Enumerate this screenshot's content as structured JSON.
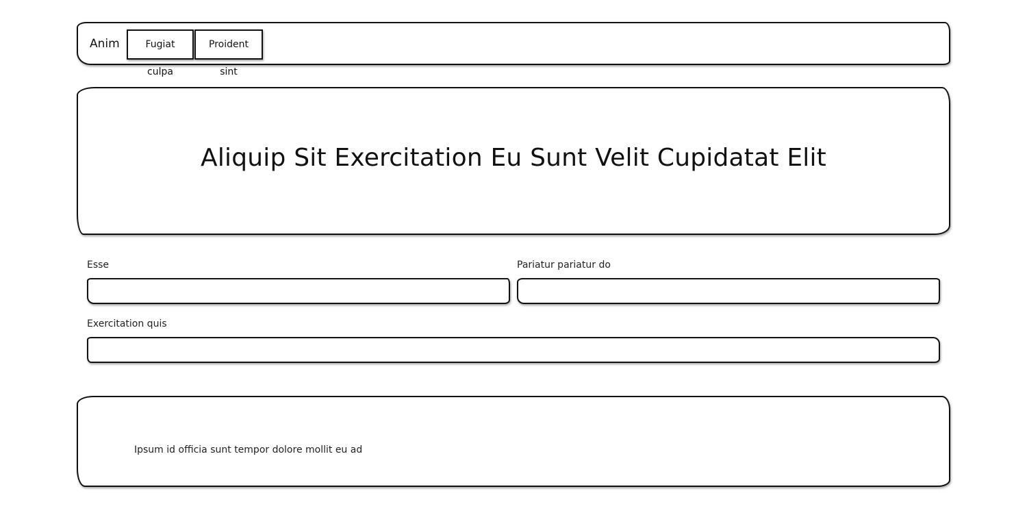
{
  "navbar": {
    "brand": "Anim",
    "buttons": [
      {
        "label": "Fugiat culpa"
      },
      {
        "label": "Proident sint"
      }
    ]
  },
  "hero": {
    "title": "Aliquip Sit Exercitation Eu Sunt Velit Cupidatat Elit"
  },
  "form": {
    "fields": [
      {
        "label": "Esse",
        "value": "",
        "placeholder": ""
      },
      {
        "label": "Pariatur pariatur do",
        "value": "",
        "placeholder": ""
      },
      {
        "label": "Exercitation quis",
        "value": "",
        "placeholder": ""
      }
    ]
  },
  "footer": {
    "text": "Ipsum id officia sunt tempor dolore mollit eu ad"
  },
  "colors": {
    "border": "#111111",
    "background": "#ffffff",
    "text": "#111111"
  }
}
